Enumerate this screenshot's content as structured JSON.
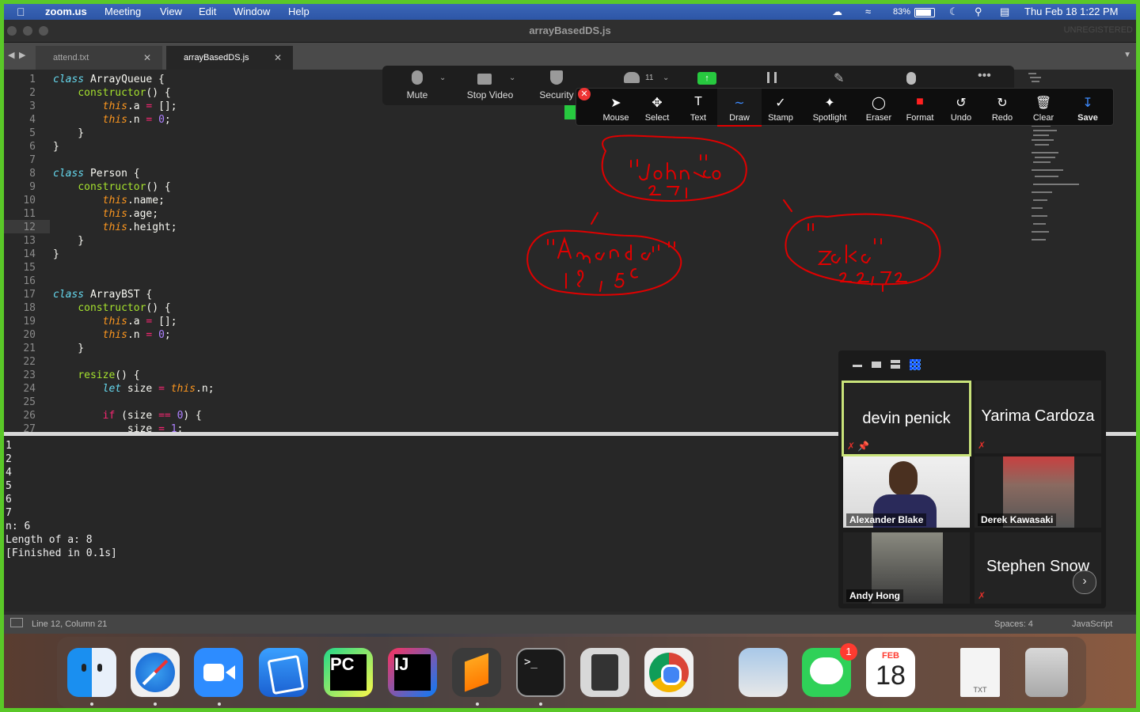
{
  "menubar": {
    "app": "zoom.us",
    "items": [
      "Meeting",
      "View",
      "Edit",
      "Window",
      "Help"
    ],
    "battery": "83%",
    "datetime": "Thu Feb 18  1:22 PM"
  },
  "window": {
    "title": "arrayBasedDS.js",
    "unregistered": "UNREGISTERED"
  },
  "tabs": [
    {
      "label": "attend.txt",
      "close": "✕"
    },
    {
      "label": "arrayBasedDS.js",
      "close": "✕"
    }
  ],
  "editor": {
    "line_numbers": [
      "1",
      "2",
      "3",
      "4",
      "5",
      "6",
      "7",
      "8",
      "9",
      "10",
      "11",
      "12",
      "13",
      "14",
      "15",
      "16",
      "17",
      "18",
      "19",
      "20",
      "21",
      "22",
      "23",
      "24",
      "25",
      "26",
      "27"
    ]
  },
  "console": {
    "lines": [
      "1",
      "2",
      "4",
      "5",
      "6",
      "7",
      "n: 6",
      "Length of a: 8",
      "[Finished in 0.1s]"
    ]
  },
  "statusbar": {
    "position": "Line 12, Column 21",
    "spaces": "Spaces: 4",
    "syntax": "JavaScript"
  },
  "zoom_toolbar": {
    "mute": "Mute",
    "stop_video": "Stop Video",
    "security": "Security",
    "participants_count": "11"
  },
  "annotate_toolbar": {
    "items": [
      "Mouse",
      "Select",
      "Text",
      "Draw",
      "Stamp",
      "Spotlight",
      "Eraser",
      "Format",
      "Undo",
      "Redo",
      "Clear",
      "Save"
    ],
    "active": "Draw"
  },
  "gallery": {
    "participants": [
      {
        "name": "devin penick"
      },
      {
        "name": "Yarima Cardoza"
      },
      {
        "name": "Alexander Blake"
      },
      {
        "name": "Derek Kawasaki"
      },
      {
        "name": "Andy Hong"
      },
      {
        "name": "Stephen Snow"
      }
    ]
  },
  "dock": {
    "calendar_month": "FEB",
    "calendar_day": "18",
    "messages_badge": "1",
    "pycharm": "PC",
    "intellij": "IJ",
    "txt_label": "TXT"
  },
  "colors": {
    "share_border": "#5ac828",
    "annotation_red": "#e00000",
    "menubar": "#3060b0"
  }
}
